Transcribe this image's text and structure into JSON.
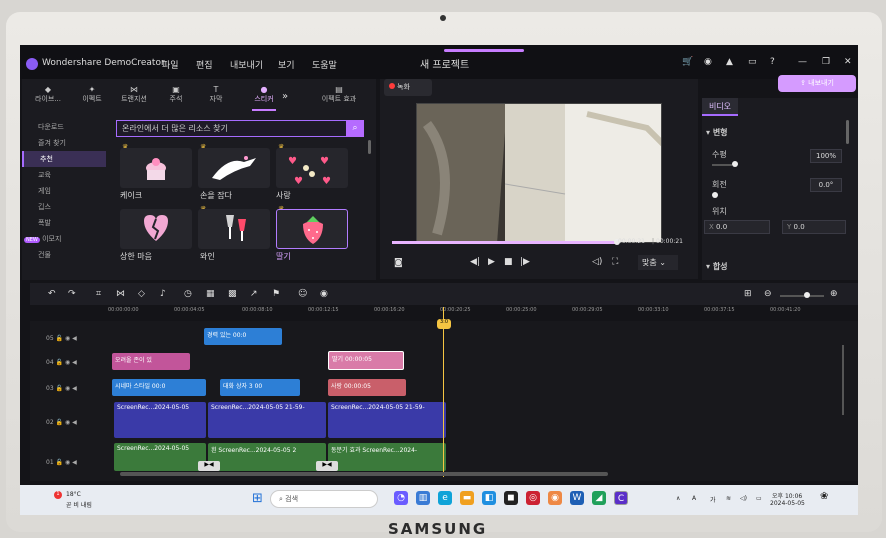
{
  "app": {
    "name": "Wondershare DemoCreator",
    "window_title": "새 프로젝트"
  },
  "menu": [
    "파일",
    "편집",
    "내보내기",
    "보기",
    "도움말"
  ],
  "export_label": "내보내기",
  "resource_tabs": [
    {
      "label": "라이브...",
      "icon": "library-icon"
    },
    {
      "label": "이펙트",
      "icon": "effects-icon"
    },
    {
      "label": "트랜지션",
      "icon": "transition-icon"
    },
    {
      "label": "주석",
      "icon": "annotation-icon"
    },
    {
      "label": "자막",
      "icon": "caption-icon"
    },
    {
      "label": "스티커",
      "icon": "sticker-icon",
      "active": true
    },
    {
      "label": "이펙트 효과",
      "icon": "effect-fx-icon"
    }
  ],
  "categories": [
    {
      "label": "다운로드"
    },
    {
      "label": "즐겨 찾기"
    },
    {
      "label": "추천",
      "active": true
    },
    {
      "label": "교육"
    },
    {
      "label": "게임"
    },
    {
      "label": "깁스"
    },
    {
      "label": "폭발"
    },
    {
      "label": "이모지",
      "badge": "NEW"
    },
    {
      "label": "건물"
    }
  ],
  "search_placeholder": "온라인에서 더 많은 리소스 찾기",
  "stickers": [
    {
      "label": "케이크"
    },
    {
      "label": "손을 잡다"
    },
    {
      "label": "사랑"
    },
    {
      "label": "상한 마음"
    },
    {
      "label": "와인"
    },
    {
      "label": "딸기"
    }
  ],
  "preview": {
    "record_label": "녹화",
    "current_time": "00:00:21",
    "total_time": "00:00:21",
    "fit_label": "맞춤",
    "progress": 0.99
  },
  "properties": {
    "tab": "비디오",
    "section": "변형",
    "scale_label": "수평",
    "scale_value": "100%",
    "rotate_label": "회전",
    "rotate_value": "0.0°",
    "position_label": "위치",
    "x_label": "X",
    "x_value": "0.0",
    "y_label": "Y",
    "y_value": "0.0",
    "composite_label": "합성"
  },
  "ruler_ticks": [
    "00:00:00:00",
    "00:00:04:05",
    "00:00:08:10",
    "00:00:12:15",
    "00:00:16:20",
    "00:00:20:25",
    "00:00:25:00",
    "00:00:29:05",
    "00:00:33:10",
    "00:00:37:15",
    "00:00:41:20"
  ],
  "playhead_label": "3:0",
  "tracks": [
    {
      "num": "05",
      "clips": [
        {
          "text": "경력 있는 00:0",
          "color": "#2d7fd6"
        }
      ]
    },
    {
      "num": "04",
      "clips": [
        {
          "text": "오려올 존이 있",
          "color": "#c2559a"
        },
        {
          "text": "딸기 00:00:05",
          "color": "#d97ba8"
        }
      ]
    },
    {
      "num": "03",
      "clips": [
        {
          "text": "시네마 스타일 00:0",
          "color": "#2d7fd6"
        },
        {
          "text": "대화 상자 3 00",
          "color": "#2d7fd6"
        },
        {
          "text": "사랑 00:00:05",
          "color": "#c95f6a"
        }
      ]
    },
    {
      "num": "02",
      "clips": [
        {
          "text": "ScreenRec...2024-05-05",
          "color": "#3a3aa8"
        },
        {
          "text": "ScreenRec...2024-05-05 21-59-",
          "color": "#3a3aa8"
        },
        {
          "text": "ScreenRec...2024-05-05 21-59-",
          "color": "#3a3aa8"
        }
      ]
    },
    {
      "num": "01",
      "clips": [
        {
          "text": "ScreenRec...2024-05-05",
          "color": "#3b7a3b"
        },
        {
          "text": "흰 ScreenRec...2024-05-05 2",
          "color": "#3b7a3b"
        },
        {
          "text": "동분기 효과 ScreenRec...2024-",
          "color": "#3b7a3b"
        }
      ]
    }
  ],
  "taskbar": {
    "weather_temp": "18°C",
    "weather_desc": "곧 비 내림",
    "search_placeholder": "검색",
    "time": "오후 10:06",
    "date": "2024-05-05",
    "lang": "가"
  }
}
